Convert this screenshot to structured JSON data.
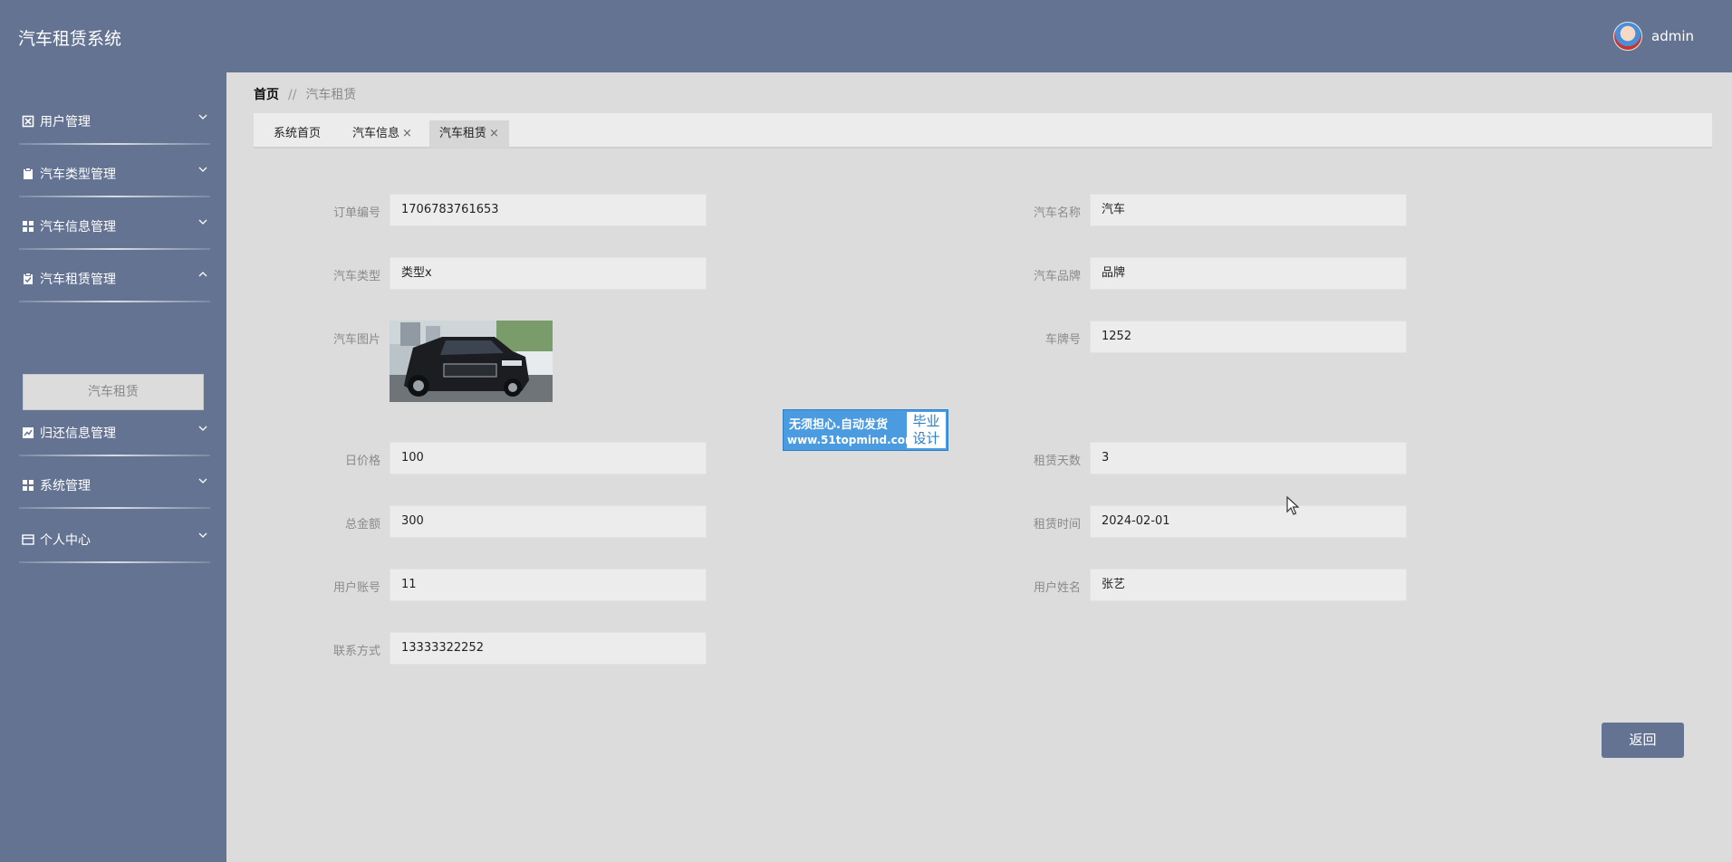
{
  "header": {
    "app_title": "汽车租赁系统",
    "username": "admin"
  },
  "sidebar": {
    "items": [
      {
        "label": "用户管理",
        "icon": "user-manage-icon",
        "expanded": false
      },
      {
        "label": "汽车类型管理",
        "icon": "clipboard-icon",
        "expanded": false
      },
      {
        "label": "汽车信息管理",
        "icon": "grid-icon",
        "expanded": false
      },
      {
        "label": "汽车租赁管理",
        "icon": "clipboard-check-icon",
        "expanded": true
      },
      {
        "label": "归还信息管理",
        "icon": "chart-icon",
        "expanded": false
      },
      {
        "label": "系统管理",
        "icon": "grid-icon",
        "expanded": false
      },
      {
        "label": "个人中心",
        "icon": "card-icon",
        "expanded": false
      }
    ],
    "sub_item": "汽车租赁"
  },
  "breadcrumb": {
    "home": "首页",
    "separator": "//",
    "current": "汽车租赁"
  },
  "tabs": [
    {
      "label": "系统首页",
      "closable": false,
      "active": false
    },
    {
      "label": "汽车信息",
      "closable": true,
      "active": false
    },
    {
      "label": "汽车租赁",
      "closable": true,
      "active": true
    }
  ],
  "tab_close_glyph": "×",
  "form": {
    "order_no": {
      "label": "订单编号",
      "value": "1706783761653"
    },
    "car_name": {
      "label": "汽车名称",
      "value": "汽车"
    },
    "car_type": {
      "label": "汽车类型",
      "value": "类型x"
    },
    "car_brand": {
      "label": "汽车品牌",
      "value": "品牌"
    },
    "car_image": {
      "label": "汽车图片"
    },
    "plate_no": {
      "label": "车牌号",
      "value": "1252"
    },
    "daily_price": {
      "label": "日价格",
      "value": "100"
    },
    "rent_days": {
      "label": "租赁天数",
      "value": "3"
    },
    "total": {
      "label": "总金额",
      "value": "300"
    },
    "rent_time": {
      "label": "租赁时间",
      "value": "2024-02-01"
    },
    "user_account": {
      "label": "用户账号",
      "value": "11"
    },
    "user_name": {
      "label": "用户姓名",
      "value": "张艺"
    },
    "contact": {
      "label": "联系方式",
      "value": "13333322252"
    }
  },
  "watermark": {
    "line1": "无须担心.自动发货",
    "line2": "www.51topmind.com",
    "badge_line1": "毕业",
    "badge_line2": "设计"
  },
  "actions": {
    "back_label": "返回"
  },
  "colors": {
    "primary": "#647391",
    "page_bg": "#dcdcdc",
    "input_bg": "#ececec",
    "watermark_blue": "#4a9be0"
  }
}
